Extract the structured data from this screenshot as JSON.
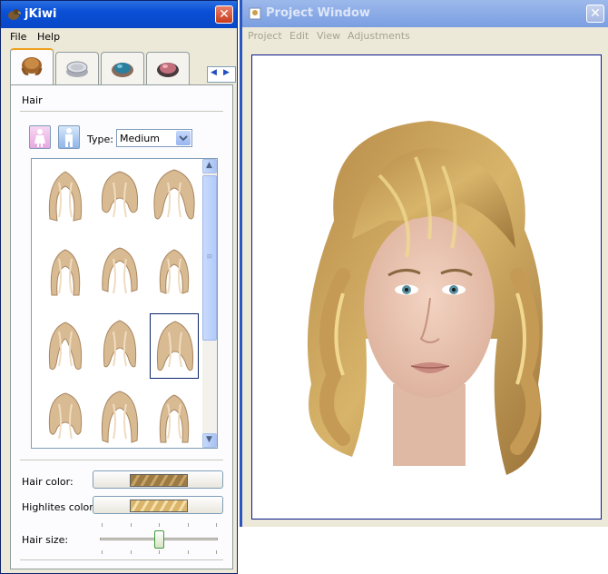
{
  "left_window": {
    "title": "jKiwi",
    "menu": [
      "File",
      "Help"
    ],
    "tabs": [
      {
        "icon": "hair-icon",
        "active": true
      },
      {
        "icon": "compact-powder-icon",
        "active": false
      },
      {
        "icon": "eyeshadow-icon",
        "active": false
      },
      {
        "icon": "blush-icon",
        "active": false
      }
    ],
    "tab_scroll": {
      "left": "◀",
      "right": "▶"
    },
    "section_title": "Hair",
    "type_label": "Type:",
    "type_value": "Medium",
    "hair_color_label": "Hair color:",
    "highlites_color_label": "Highlites color:",
    "hair_size_label": "Hair size:",
    "hair_size_value": 0.5,
    "hair_color": "#9c7a44",
    "highlites_color": "#d9b46a",
    "gallery_selected_index": 8,
    "scroll_up": "▲",
    "scroll_down": "▼",
    "scroll_grip": "≡"
  },
  "right_window": {
    "title": "Project Window",
    "menu": [
      "Project",
      "Edit",
      "View",
      "Adjustments"
    ]
  },
  "close_label": "✕"
}
